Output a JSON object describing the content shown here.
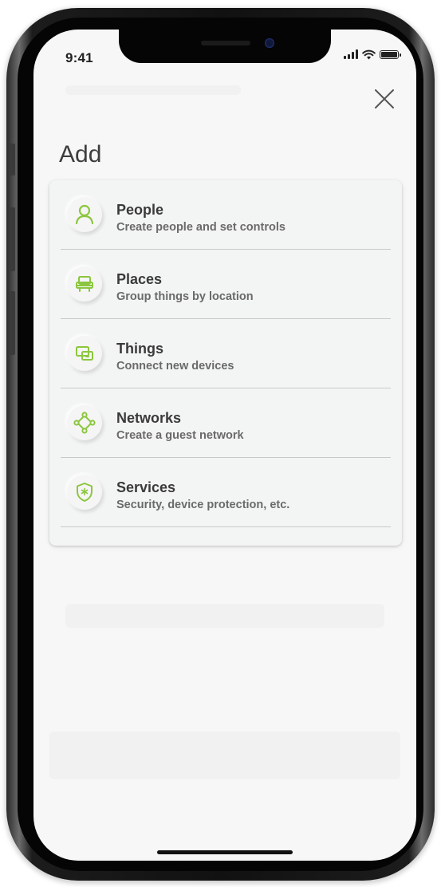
{
  "status_bar": {
    "time": "9:41",
    "battery_level": 1.0
  },
  "header": {
    "title": "Add",
    "close_icon": "close-icon"
  },
  "menu": {
    "accent_color": "#8cc63f",
    "items": [
      {
        "label": "People",
        "description": "Create people and set controls",
        "icon": "person-icon"
      },
      {
        "label": "Places",
        "description": "Group things by location",
        "icon": "armchair-icon"
      },
      {
        "label": "Things",
        "description": "Connect new devices",
        "icon": "devices-icon"
      },
      {
        "label": "Networks",
        "description": "Create a guest network",
        "icon": "network-icon"
      },
      {
        "label": "Services",
        "description": "Security, device protection, etc.",
        "icon": "shield-icon"
      }
    ]
  }
}
